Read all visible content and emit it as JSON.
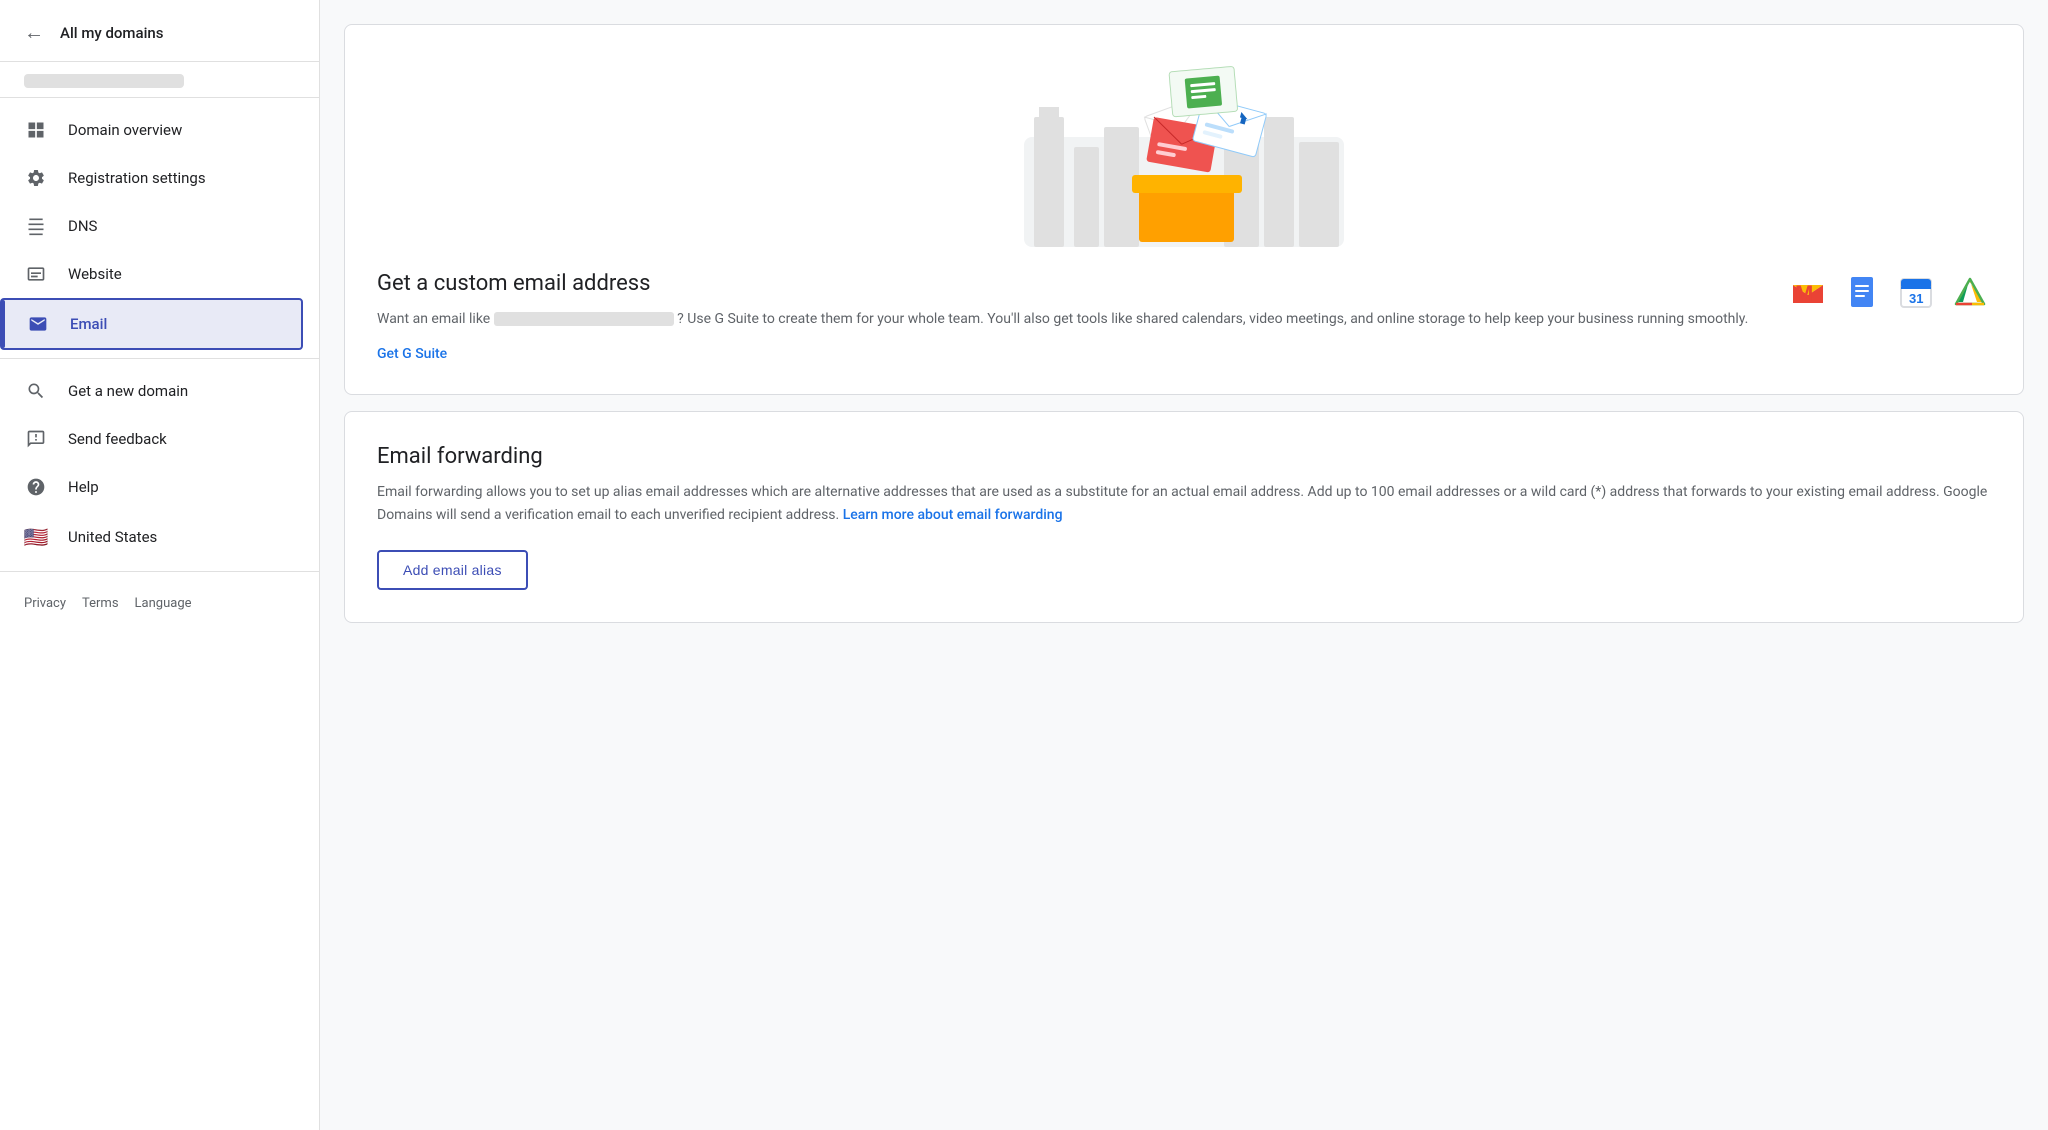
{
  "sidebar": {
    "back_label": "All my domains",
    "domain_placeholder": "domain_blurred",
    "nav_items": [
      {
        "id": "domain-overview",
        "label": "Domain overview",
        "icon": "grid-icon",
        "active": false
      },
      {
        "id": "registration-settings",
        "label": "Registration settings",
        "icon": "gear-icon",
        "active": false
      },
      {
        "id": "dns",
        "label": "DNS",
        "icon": "dns-icon",
        "active": false
      },
      {
        "id": "website",
        "label": "Website",
        "icon": "website-icon",
        "active": false
      },
      {
        "id": "email",
        "label": "Email",
        "icon": "email-icon",
        "active": true
      }
    ],
    "bottom_items": [
      {
        "id": "get-new-domain",
        "label": "Get a new domain",
        "icon": "search-icon"
      },
      {
        "id": "send-feedback",
        "label": "Send feedback",
        "icon": "feedback-icon"
      },
      {
        "id": "help",
        "label": "Help",
        "icon": "help-icon"
      },
      {
        "id": "united-states",
        "label": "United States",
        "icon": "flag-icon"
      }
    ],
    "footer": {
      "privacy": "Privacy",
      "terms": "Terms",
      "language": "Language"
    }
  },
  "main": {
    "custom_email": {
      "title": "Get a custom email address",
      "description_before": "Want an email like",
      "description_blurred": true,
      "description_after": "? Use G Suite to create them for your whole team. You'll also get tools like shared calendars, video meetings, and online storage to help keep your business running smoothly.",
      "action_label": "Get G Suite"
    },
    "email_forwarding": {
      "title": "Email forwarding",
      "description": "Email forwarding allows you to set up alias email addresses which are alternative addresses that are used as a substitute for an actual email address. Add up to 100 email addresses or a wild card (*) address that forwards to your existing email address. Google Domains will send a verification email to each unverified recipient address.",
      "learn_more_text": "Learn more about email forwarding",
      "add_alias_label": "Add email alias"
    }
  },
  "colors": {
    "accent": "#3c4db5",
    "link": "#1a73e8",
    "text_primary": "#202124",
    "text_secondary": "#5f6368",
    "active_bg": "#e8eaf6",
    "border": "#dadce0"
  }
}
